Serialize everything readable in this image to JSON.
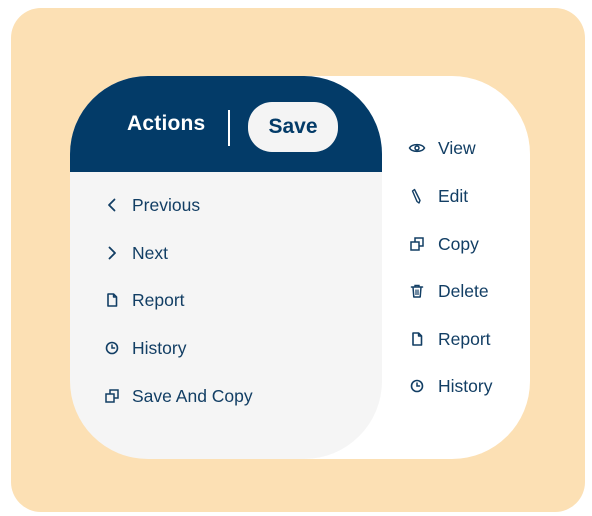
{
  "header": {
    "title": "Actions",
    "save_label": "Save"
  },
  "left_menu": {
    "items": [
      {
        "label": "Previous",
        "icon": "chevron-left-icon"
      },
      {
        "label": "Next",
        "icon": "chevron-right-icon"
      },
      {
        "label": "Report",
        "icon": "document-icon"
      },
      {
        "label": "History",
        "icon": "clock-icon"
      },
      {
        "label": "Save And Copy",
        "icon": "copy-icon"
      }
    ]
  },
  "right_menu": {
    "items": [
      {
        "label": "View",
        "icon": "eye-icon"
      },
      {
        "label": "Edit",
        "icon": "pencil-icon"
      },
      {
        "label": "Copy",
        "icon": "copy-icon"
      },
      {
        "label": "Delete",
        "icon": "trash-icon"
      },
      {
        "label": "Report",
        "icon": "document-icon"
      },
      {
        "label": "History",
        "icon": "clock-icon"
      }
    ]
  },
  "colors": {
    "backdrop": "#fce0b4",
    "header": "#033b68",
    "text": "#123e64",
    "panel": "#f5f5f5",
    "card": "#ffffff"
  }
}
